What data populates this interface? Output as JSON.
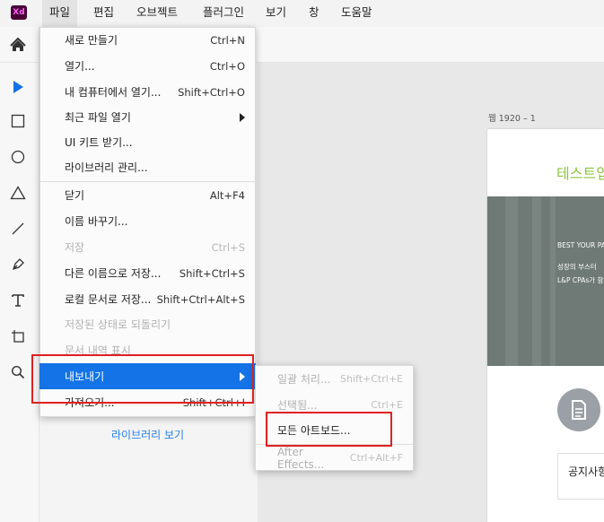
{
  "app": {
    "logo_text": "Xd",
    "logo_color": "#470137"
  },
  "menubar": {
    "items": [
      {
        "label": "파일"
      },
      {
        "label": "편집"
      },
      {
        "label": "오브젝트"
      },
      {
        "label": "플러그인"
      },
      {
        "label": "보기"
      },
      {
        "label": "창"
      },
      {
        "label": "도움말"
      }
    ]
  },
  "tools": [
    "home-icon",
    "select-icon",
    "rectangle-icon",
    "ellipse-icon",
    "triangle-icon",
    "line-icon",
    "pen-icon",
    "text-icon",
    "artboard-icon",
    "zoom-icon"
  ],
  "file_menu": {
    "items": [
      {
        "label": "새로 만들기",
        "shortcut": "Ctrl+N"
      },
      {
        "label": "열기...",
        "shortcut": "Ctrl+O"
      },
      {
        "label": "내 컴퓨터에서 열기...",
        "shortcut": "Shift+Ctrl+O"
      },
      {
        "label": "최근 파일 열기",
        "shortcut": ""
      },
      {
        "label": "UI 키트 받기...",
        "shortcut": ""
      },
      {
        "label": "라이브러리 관리...",
        "shortcut": ""
      },
      {
        "label": "닫기",
        "shortcut": "Alt+F4"
      },
      {
        "label": "이름 바꾸기...",
        "shortcut": ""
      },
      {
        "label": "저장",
        "shortcut": "Ctrl+S"
      },
      {
        "label": "다른 이름으로 저장...",
        "shortcut": "Shift+Ctrl+S"
      },
      {
        "label": "로컬 문서로 저장...",
        "shortcut": "Shift+Ctrl+Alt+S"
      },
      {
        "label": "저장된 상태로 되돌리기",
        "shortcut": ""
      },
      {
        "label": "문서 내역 표시",
        "shortcut": ""
      },
      {
        "label": "내보내기",
        "shortcut": ""
      },
      {
        "label": "가져오기...",
        "shortcut": "Shift+Ctrl+I"
      }
    ]
  },
  "export_submenu": {
    "items": [
      {
        "label": "일괄 처리...",
        "shortcut": "Shift+Ctrl+E"
      },
      {
        "label": "선택됨...",
        "shortcut": "Ctrl+E"
      },
      {
        "label": "모든 아트보드...",
        "shortcut": ""
      },
      {
        "label": "After Effects...",
        "shortcut": "Ctrl+Alt+F"
      }
    ]
  },
  "library": {
    "link_label": "라이브러리 보기"
  },
  "canvas": {
    "artboard_label": "웹 1920 – 1",
    "heading": "테스트입",
    "hero_line1": "BEST YOUR PA",
    "hero_line2": "성장의 부스터",
    "hero_line3": "L&P CPAs가 함께",
    "notice": "공지사항"
  },
  "colors": {
    "accent": "#1473e6",
    "highlight": "#e02020",
    "heading_green": "#8dc63f"
  }
}
